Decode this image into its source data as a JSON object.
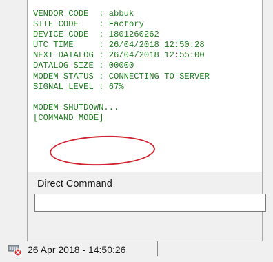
{
  "terminal": {
    "lines": [
      "VENDOR CODE  : abbuk",
      "SITE CODE    : Factory",
      "DEVICE CODE  : 1801260262",
      "UTC TIME     : 26/04/2018 12:50:28",
      "NEXT DATALOG : 26/04/2018 12:55:00",
      "DATALOG SIZE : 00000",
      "MODEM STATUS : CONNECTING TO SERVER",
      "SIGNAL LEVEL : 67%",
      "",
      "MODEM SHUTDOWN...",
      "[COMMAND MODE]"
    ],
    "text_color": "#1e7a1e",
    "highlight_color": "#d22230"
  },
  "direct_command": {
    "label": "Direct Command",
    "value": "",
    "placeholder": ""
  },
  "statusbar": {
    "connection_icon": "disconnected-network-icon",
    "timestamp": "26 Apr 2018 - 14:50:26"
  }
}
